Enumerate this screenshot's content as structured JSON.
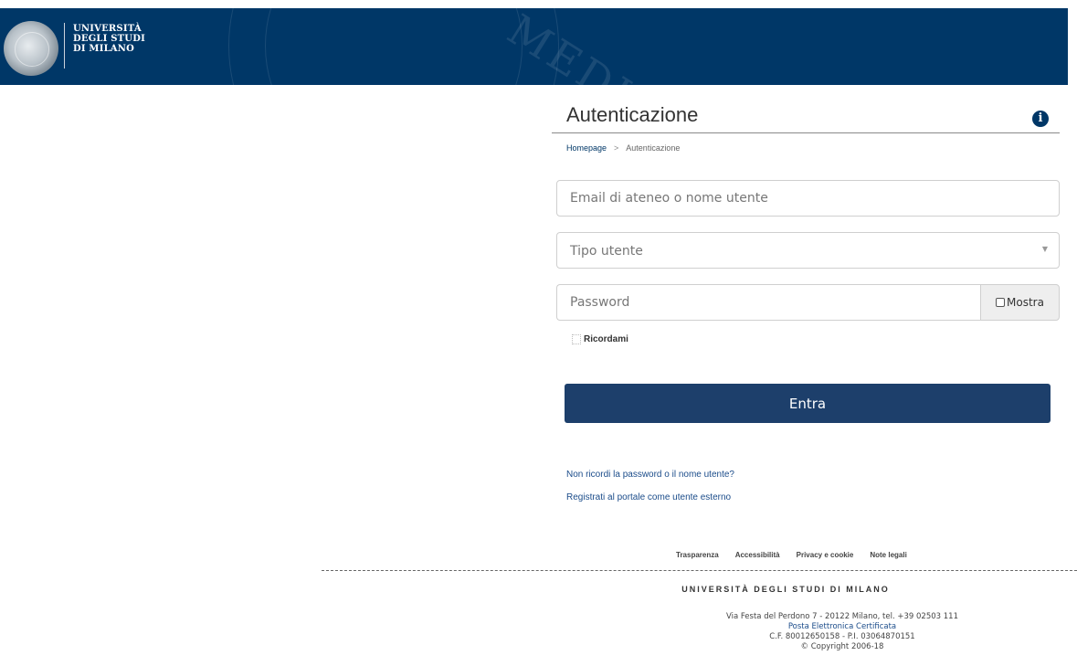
{
  "header": {
    "wordmark_line1": "UNIVERSITÀ",
    "wordmark_line2": "DEGLI STUDI",
    "wordmark_line3": "DI MILANO",
    "bg_text": "MEDI",
    "logo_icon": "university-seal-icon",
    "color": "#003767"
  },
  "page": {
    "title": "Autenticazione",
    "info_icon": "i",
    "breadcrumb": {
      "home": "Homepage",
      "separator": ">",
      "current": "Autenticazione"
    }
  },
  "form": {
    "email_placeholder": "Email di ateneo o nome utente",
    "tipo_placeholder": "Tipo utente",
    "tipo_caret": "▼",
    "password_placeholder": "Password",
    "mostra_label": "Mostra",
    "remember_label": "Ricordami",
    "submit_label": "Entra",
    "submit_color": "#1d3f6b"
  },
  "links": {
    "forgot": "Non ricordi la password o il nome utente?",
    "register": "Registrati al portale come utente esterno"
  },
  "footer": {
    "links": [
      "Trasparenza",
      "Accessibilità",
      "Privacy e cookie",
      "Note legali"
    ],
    "university": "UNIVERSITÀ DEGLI STUDI DI MILANO",
    "address": "Via Festa del Perdono 7 - 20122 Milano, tel. +39 02503 111",
    "pec": "Posta Elettronica Certificata",
    "tax": "C.F. 80012650158 - P.I. 03064870151",
    "copyright": "© Copyright 2006-18"
  }
}
